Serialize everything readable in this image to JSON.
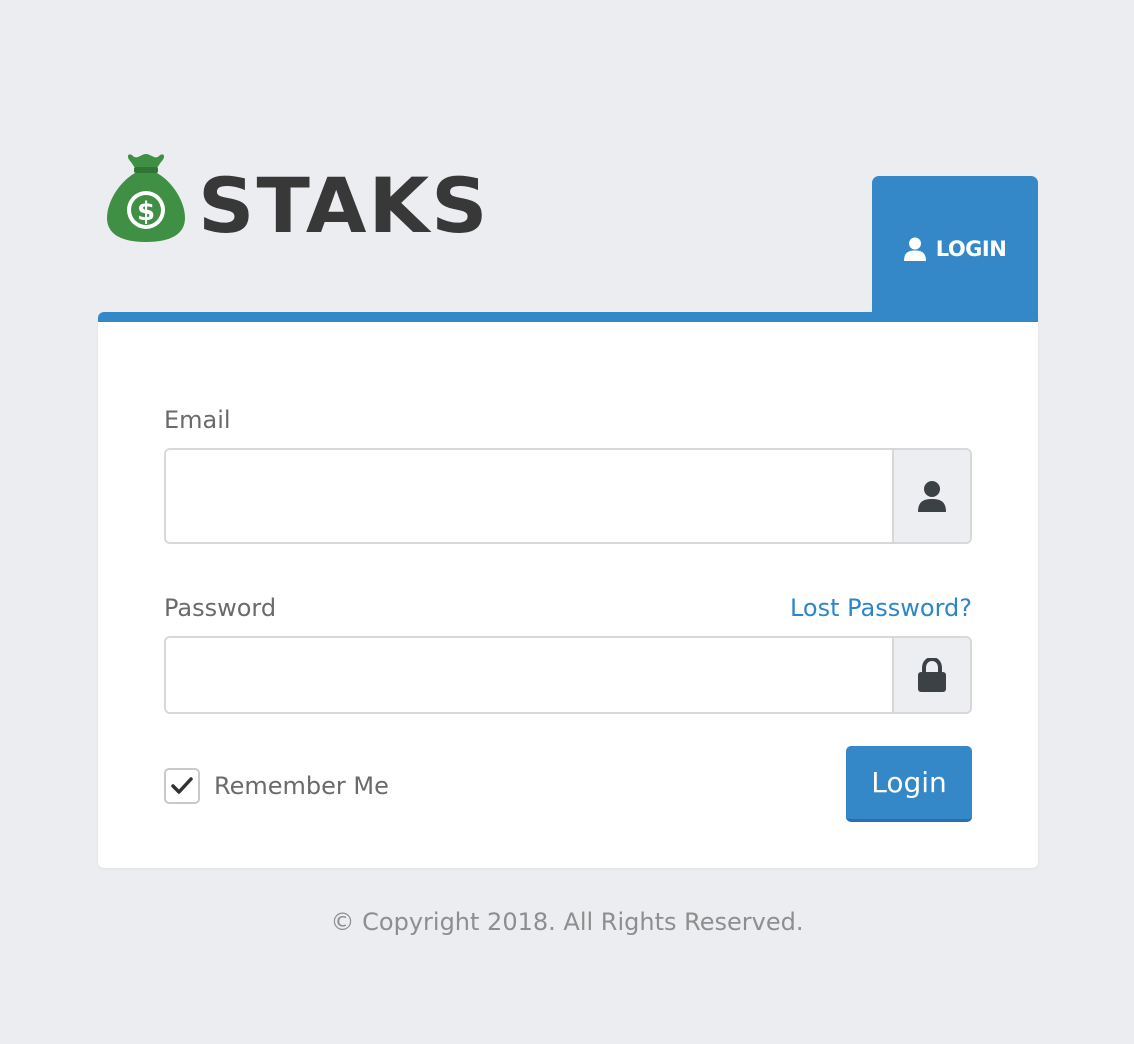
{
  "brand": {
    "name": "STAKS",
    "logo_icon": "money-bag-icon",
    "logo_symbol": "$",
    "colors": {
      "bag": "#3f8f45",
      "coin": "#ffffff",
      "text": "#383838"
    }
  },
  "tab": {
    "label": "LOGIN",
    "icon": "user-icon",
    "color": "#3588c8"
  },
  "form": {
    "email": {
      "label": "Email",
      "value": "",
      "placeholder": "",
      "icon": "user-icon"
    },
    "password": {
      "label": "Password",
      "value": "",
      "placeholder": "",
      "icon": "lock-icon"
    },
    "lost_password_label": "Lost Password?",
    "remember": {
      "label": "Remember Me",
      "checked": true
    },
    "submit_label": "Login"
  },
  "footer": {
    "text": "© Copyright 2018. All Rights Reserved."
  },
  "colors": {
    "accent": "#3588c8",
    "link": "#2c86c9",
    "background": "#ebedf1"
  }
}
